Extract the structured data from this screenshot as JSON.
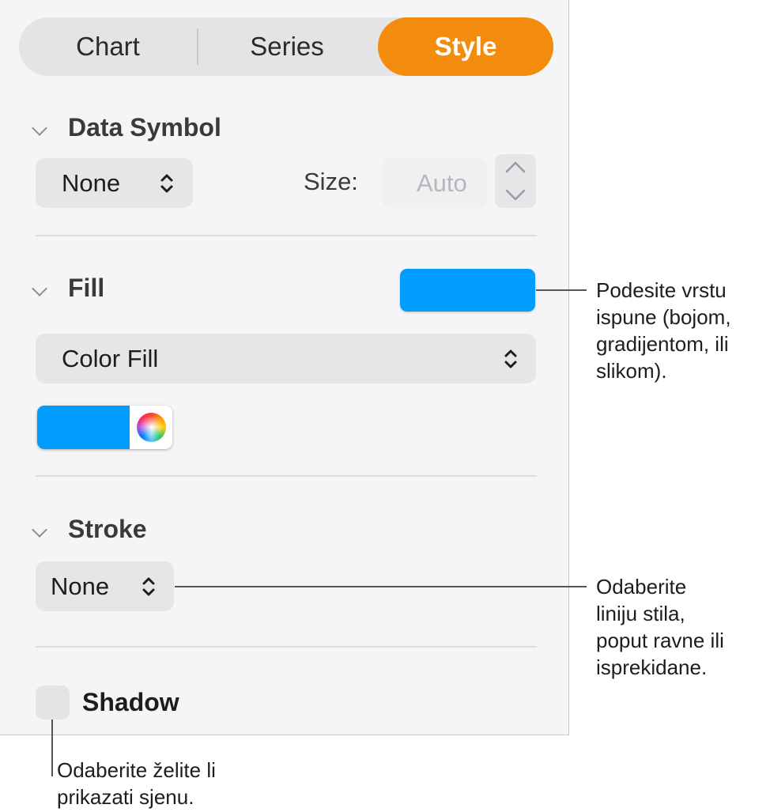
{
  "tabs": {
    "chart": "Chart",
    "series": "Series",
    "style": "Style"
  },
  "data_symbol": {
    "title": "Data Symbol",
    "value": "None",
    "size_label": "Size:",
    "size_placeholder": "Auto"
  },
  "fill": {
    "title": "Fill",
    "type_value": "Color Fill",
    "color": "#009cff"
  },
  "stroke": {
    "title": "Stroke",
    "value": "None"
  },
  "shadow": {
    "label": "Shadow",
    "checked": false
  },
  "callouts": {
    "fill": [
      "Podesite vrstu",
      "ispune (bojom,",
      "gradijentom, ili",
      "slikom)."
    ],
    "stroke": [
      "Odaberite",
      "liniju stila,",
      "poput ravne ili",
      "isprekidane."
    ],
    "shadow": [
      "Odaberite želite li",
      "prikazati sjenu."
    ]
  },
  "colors": {
    "accent": "#f38c0c",
    "fill_blue": "#009cff"
  }
}
